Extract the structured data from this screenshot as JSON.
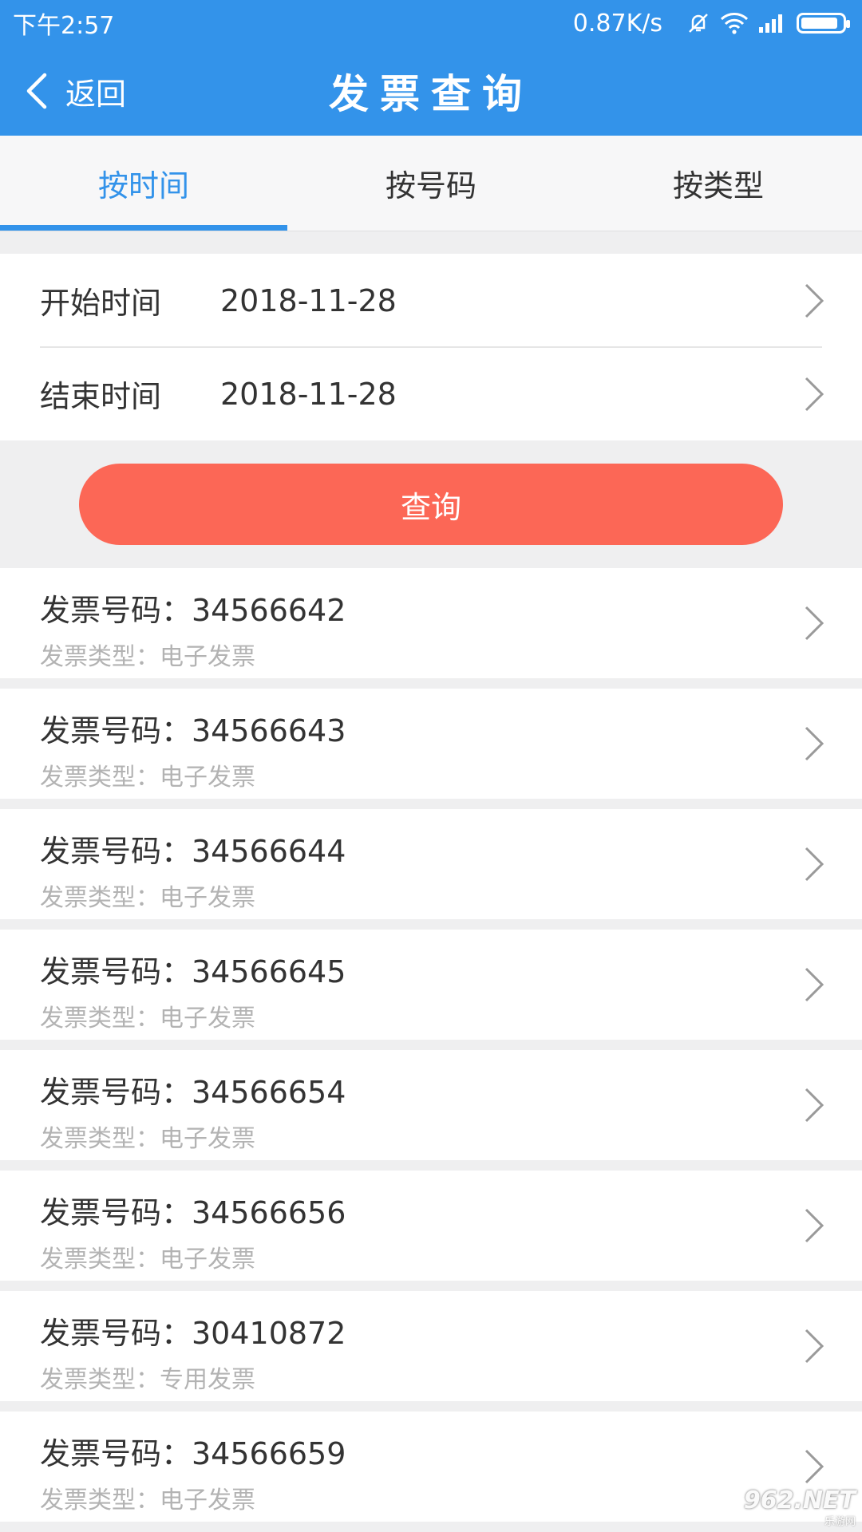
{
  "status_bar": {
    "time": "下午2:57",
    "network_rate": "0.87K/s",
    "battery_level": 0.9
  },
  "header": {
    "back_label": "返回",
    "title": "发票查询"
  },
  "tabs": [
    {
      "label": "按时间",
      "active": true
    },
    {
      "label": "按号码",
      "active": false
    },
    {
      "label": "按类型",
      "active": false
    }
  ],
  "date_filter": {
    "start_label": "开始时间",
    "start_value": "2018-11-28",
    "end_label": "结束时间",
    "end_value": "2018-11-28"
  },
  "query_button": "查询",
  "invoices": [
    {
      "number": "发票号码：34566642",
      "type": "发票类型：电子发票"
    },
    {
      "number": "发票号码：34566643",
      "type": "发票类型：电子发票"
    },
    {
      "number": "发票号码：34566644",
      "type": "发票类型：电子发票"
    },
    {
      "number": "发票号码：34566645",
      "type": "发票类型：电子发票"
    },
    {
      "number": "发票号码：34566654",
      "type": "发票类型：电子发票"
    },
    {
      "number": "发票号码：34566656",
      "type": "发票类型：电子发票"
    },
    {
      "number": "发票号码：30410872",
      "type": "发票类型：专用发票"
    },
    {
      "number": "发票号码：34566659",
      "type": "发票类型：电子发票"
    }
  ],
  "watermark": {
    "logo": "962.NET",
    "sub": "乐游网"
  },
  "colors": {
    "primary": "#3393ea",
    "accent_button": "#fc6756",
    "background": "#efeff0",
    "secondary_text": "#b3b3b3"
  }
}
